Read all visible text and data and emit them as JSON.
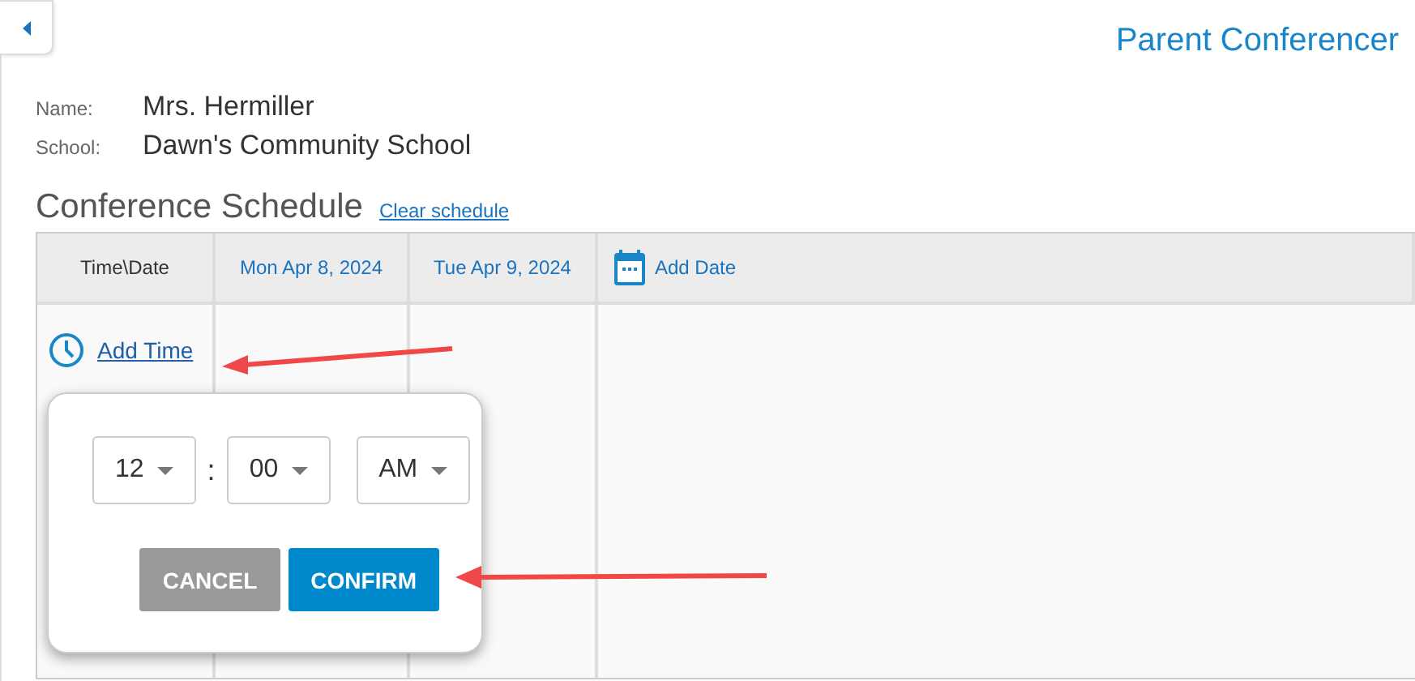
{
  "app_title": "Parent Conferencer",
  "details": [
    {
      "label": "Name:",
      "value": "Mrs. Hermiller"
    },
    {
      "label": "School:",
      "value": "Dawn's Community School"
    }
  ],
  "schedule": {
    "heading": "Conference Schedule",
    "clear_link": "Clear schedule",
    "columns": [
      {
        "label": "Time\\Date",
        "kind": "corner"
      },
      {
        "label": "Mon Apr 8, 2024",
        "kind": "date"
      },
      {
        "label": "Tue Apr 9, 2024",
        "kind": "date"
      },
      {
        "label": "Add Date",
        "kind": "add"
      }
    ],
    "add_time": "Add Time"
  },
  "time_popover": {
    "selects": [
      {
        "value": "12"
      },
      {
        "value": "00"
      },
      {
        "value": "AM"
      }
    ],
    "separator": ":",
    "buttons": [
      {
        "label": "CANCEL",
        "kind": "secondary"
      },
      {
        "label": "CONFIRM",
        "kind": "primary"
      }
    ]
  }
}
